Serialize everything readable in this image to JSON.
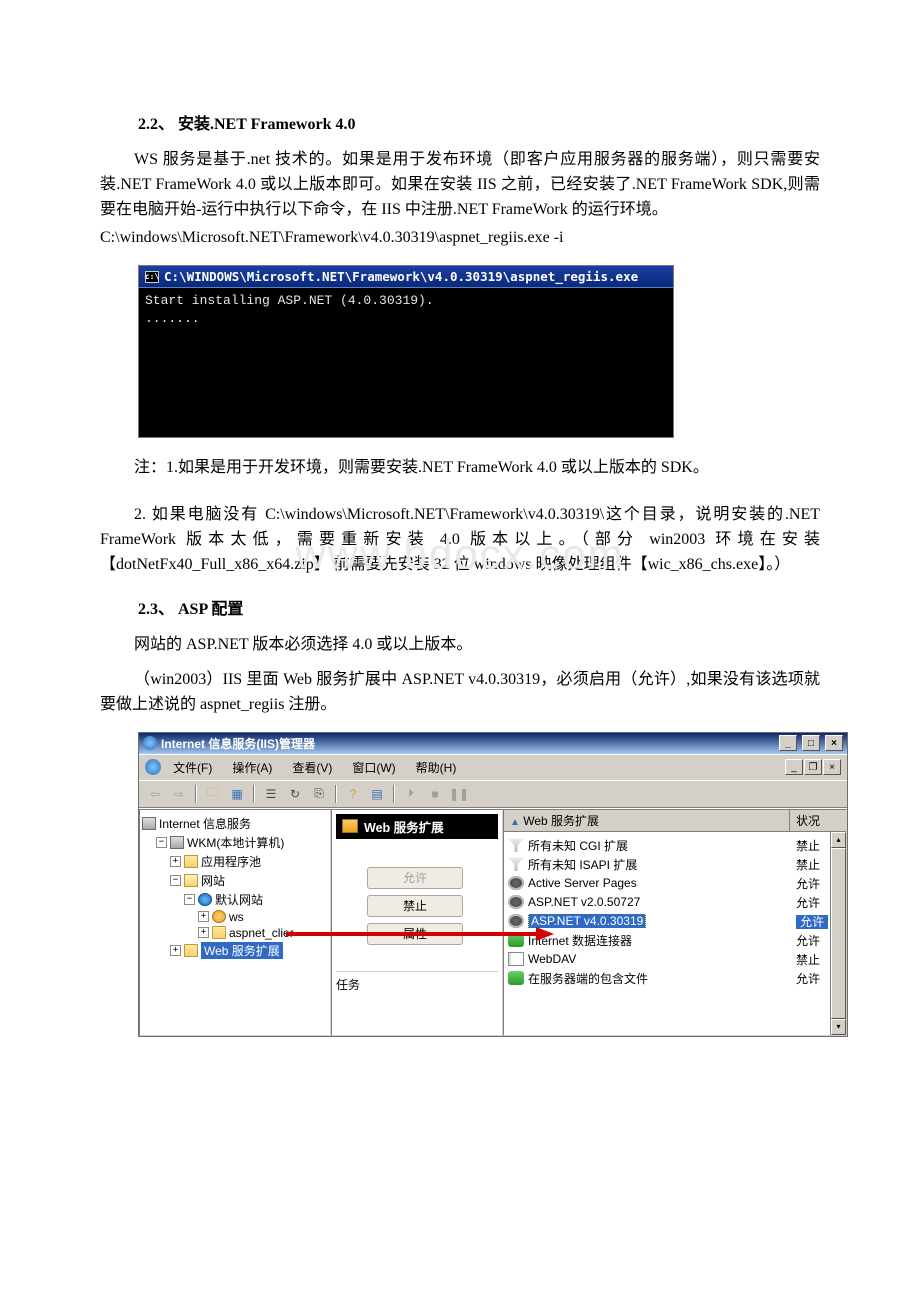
{
  "doc": {
    "section22_title": "2.2、 安装.NET Framework 4.0",
    "para1": "WS 服务是基于.net 技术的。如果是用于发布环境（即客户应用服务器的服务端），则只需要安装.NET FrameWork 4.0 或以上版本即可。如果在安装 IIS 之前，已经安装了.NET FrameWork SDK,则需要在电脑开始-运行中执行以下命令，在 IIS 中注册.NET FrameWork 的运行环境。",
    "cmd": "C:\\windows\\Microsoft.NET\\Framework\\v4.0.30319\\aspnet_regiis.exe -i",
    "note1": "注：1.如果是用于开发环境，则需要安装.NET FrameWork 4.0 或以上版本的 SDK。",
    "note2": "2. 如果电脑没有 C:\\windows\\Microsoft.NET\\Framework\\v4.0.30319\\这个目录，说明安装的.NET FrameWork 版本太低，需要重新安装 4.0 版本以上。（部分 win2003 环境在安装【dotNetFx40_Full_x86_x64.zip】 前需要先安装 32 位 windows 映像处理组件【wic_x86_chs.exe】。）",
    "section23_title": "2.3、 ASP 配置",
    "para2": "网站的 ASP.NET 版本必须选择 4.0 或以上版本。",
    "para3": "（win2003）IIS 里面 Web 服务扩展中 ASP.NET v4.0.30319，必须启用（允许）,如果没有该选项就要做上述说的 aspnet_regiis 注册。",
    "watermark": "www.bdocx.com"
  },
  "console": {
    "title_prefix": "C:\\WINDOWS\\Microsoft.NET\\Framework\\v4.0.30319\\aspnet_regiis.exe",
    "line1": "Start installing ASP.NET (4.0.30319).",
    "line2": "......."
  },
  "iis": {
    "title": "Internet 信息服务(IIS)管理器",
    "menu": {
      "file": "文件(F)",
      "action": "操作(A)",
      "view": "查看(V)",
      "window": "窗口(W)",
      "help": "帮助(H)"
    },
    "tree": {
      "root": "Internet 信息服务",
      "host": "WKM(本地计算机)",
      "apppool": "应用程序池",
      "sites": "网站",
      "default_site": "默认网站",
      "ws": "ws",
      "client": "aspnet_clier",
      "webext": "Web 服务扩展"
    },
    "mid": {
      "title": "Web 服务扩展",
      "allow": "允许",
      "prohibit": "禁止",
      "properties": "属性",
      "tasks": "任务"
    },
    "ext_header": {
      "col1": "Web 服务扩展",
      "col2": "状况"
    },
    "ext": [
      {
        "icon": "filter",
        "name": "所有未知 CGI 扩展",
        "status": "禁止"
      },
      {
        "icon": "filter",
        "name": "所有未知 ISAPI 扩展",
        "status": "禁止"
      },
      {
        "icon": "gear",
        "name": "Active Server Pages",
        "status": "允许"
      },
      {
        "icon": "gear",
        "name": "ASP.NET v2.0.50727",
        "status": "允许"
      },
      {
        "icon": "gear",
        "name": "ASP.NET v4.0.30319",
        "status": "允许",
        "selected": true
      },
      {
        "icon": "chain",
        "name": "Internet 数据连接器",
        "status": "允许"
      },
      {
        "icon": "doc",
        "name": "WebDAV",
        "status": "禁止"
      },
      {
        "icon": "chain",
        "name": "在服务器端的包含文件",
        "status": "允许"
      }
    ]
  }
}
